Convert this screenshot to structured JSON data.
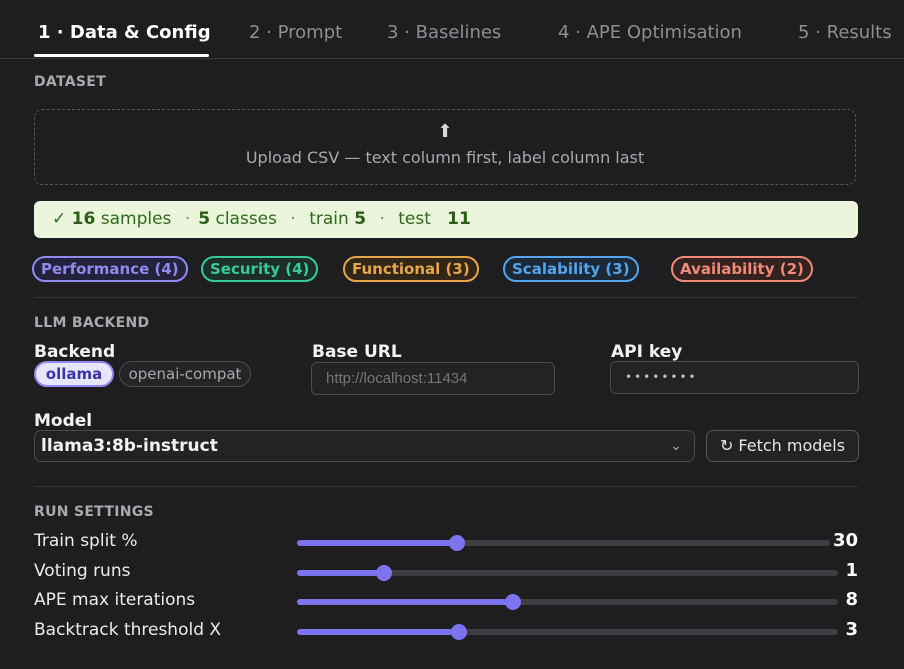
{
  "tabs": [
    {
      "label": "1 · Data & Config",
      "active": true
    },
    {
      "label": "2 · Prompt"
    },
    {
      "label": "3 · Baselines"
    },
    {
      "label": "4 · APE Optimisation"
    },
    {
      "label": "5 · Results"
    }
  ],
  "dataset": {
    "heading": "DATASET",
    "upload_icon": "⬆",
    "upload_text": "Upload CSV — text column first, label column last",
    "stats": {
      "check": "✓",
      "samples_value": "16",
      "samples_label": "samples",
      "classes_value": "5",
      "classes_label": "classes",
      "train_label": "train",
      "train_value": "5",
      "test_label": "test",
      "test_value": "11"
    },
    "classes": [
      {
        "label": "Performance (4)",
        "color": "#8f8af0",
        "bg": "#24223a"
      },
      {
        "label": "Security (4)",
        "color": "#37c99a",
        "bg": "#1d2e2a"
      },
      {
        "label": "Functional (3)",
        "color": "#e7a54b",
        "bg": "#302719"
      },
      {
        "label": "Scalability (3)",
        "color": "#55a4ee",
        "bg": "#1d2836"
      },
      {
        "label": "Availability (2)",
        "color": "#f08a78",
        "bg": "#332220"
      }
    ]
  },
  "llm": {
    "heading": "LLM BACKEND",
    "backend_label": "Backend",
    "backend_options": [
      "ollama",
      "openai-compat"
    ],
    "backend_selected": "ollama",
    "base_url_label": "Base URL",
    "base_url_placeholder": "http://localhost:11434",
    "api_key_label": "API key",
    "api_key_value": "••••••••",
    "model_label": "Model",
    "model_value": "llama3:8b-instruct",
    "chevron": "⌄",
    "fetch_button": "↻ Fetch models"
  },
  "run": {
    "heading": "RUN SETTINGS",
    "sliders": [
      {
        "label": "Train split %",
        "value": "30",
        "fraction": 0.3
      },
      {
        "label": "Voting runs",
        "value": "1",
        "fraction": 0.16
      },
      {
        "label": "APE max iterations",
        "value": "8",
        "fraction": 0.4
      },
      {
        "label": "Backtrack threshold X",
        "value": "3",
        "fraction": 0.3
      }
    ]
  },
  "colors": {
    "accent": "#7b74ee",
    "success_bg": "#eaf5dc",
    "success_text": "#2f6a1c"
  }
}
